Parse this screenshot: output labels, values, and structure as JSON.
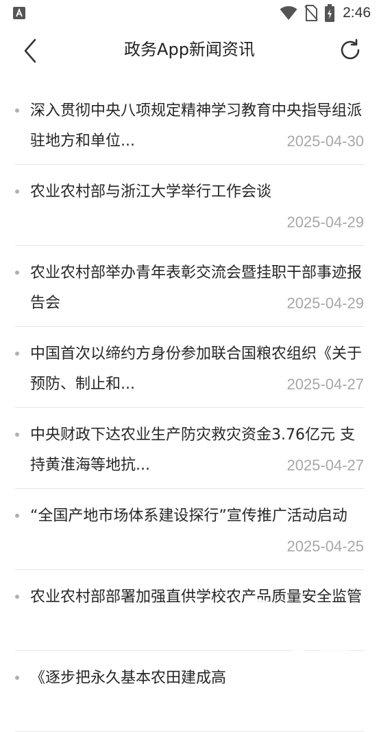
{
  "status_bar": {
    "time": "2:46",
    "left_icon": "a-badge-icon",
    "icons": [
      "wifi-icon",
      "no-sim-icon",
      "battery-charging-icon"
    ]
  },
  "app_bar": {
    "title": "政务App新闻资讯",
    "back_icon": "chevron-left-icon",
    "refresh_icon": "refresh-icon"
  },
  "news": [
    {
      "title": "深入贯彻中央八项规定精神学习教育中央指导组派驻地方和单位...",
      "date": "2025-04-30"
    },
    {
      "title": "农业农村部与浙江大学举行工作会谈",
      "date": "2025-04-29"
    },
    {
      "title": "农业农村部举办青年表彰交流会暨挂职干部事迹报告会",
      "date": "2025-04-29"
    },
    {
      "title": "中国首次以缔约方身份参加联合国粮农组织《关于预防、制止和...",
      "date": "2025-04-27"
    },
    {
      "title": "中央财政下达农业生产防灾救灾资金3.76亿元 支持黄淮海等地抗...",
      "date": "2025-04-27"
    },
    {
      "title": "“全国产地市场体系建设探行”宣传推广活动启动",
      "date": "2025-04-25"
    },
    {
      "title": "农业农村部部署加强直供学校农产品质量安全监管",
      "date": ""
    },
    {
      "title": "《逐步把永久基本农田建成高",
      "date": ""
    }
  ],
  "colors": {
    "text": "#262626",
    "date": "#a8a8a8",
    "divider": "#e6e6e6",
    "dot": "#b0b0b0"
  }
}
